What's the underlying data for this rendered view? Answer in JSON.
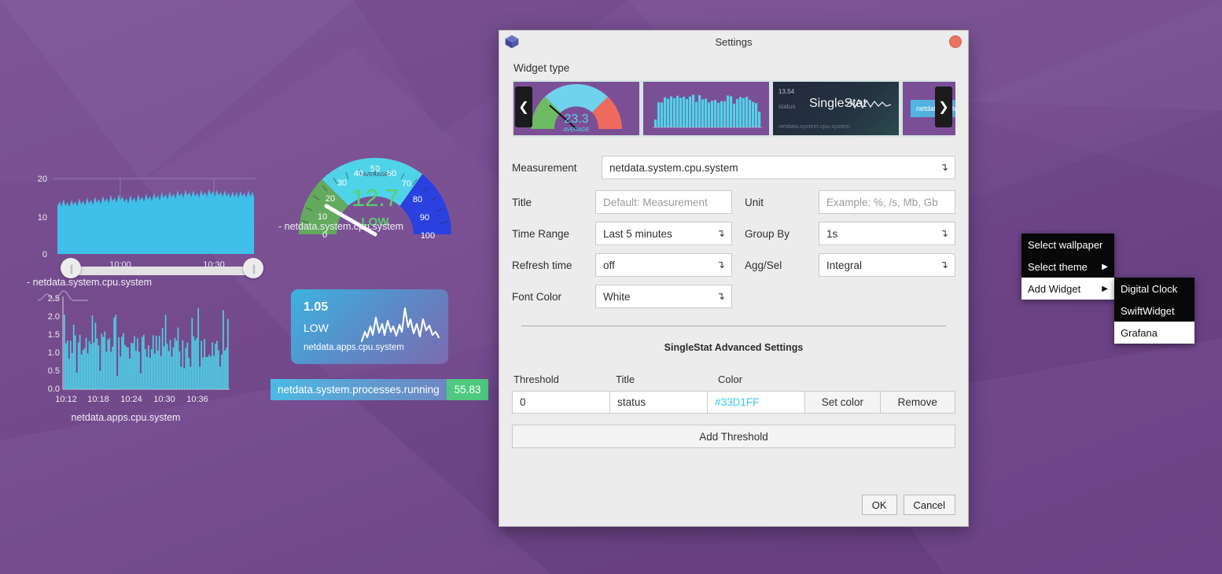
{
  "desktop": {
    "wallpaper_color": "#7b4f96",
    "widgets": {
      "top_chart": {
        "caption": "- netdata.system.cpu.system",
        "y_ticks": [
          "20",
          "10",
          "0"
        ],
        "x_ticks": [
          "10:00",
          "10:30"
        ],
        "slider_handle_glyph": "||"
      },
      "gauge": {
        "value": "12.7",
        "status": "LOW",
        "band_label": "AVERAGE",
        "caption": "- netdata.system.cpu.system",
        "ticks": [
          "0",
          "10",
          "20",
          "30",
          "40",
          "50",
          "60",
          "70",
          "80",
          "90",
          "100"
        ],
        "color_green": "#63a95e",
        "color_cyan": "#4fd3e8",
        "color_blue": "#2a41e0",
        "value_color": "#5ad06a"
      },
      "bottom_chart": {
        "caption": "netdata.apps.cpu.system",
        "y_ticks": [
          "2.5",
          "2.0",
          "1.5",
          "1.0",
          "0.5",
          "0.0"
        ],
        "x_ticks": [
          "10:12",
          "10:18",
          "10:24",
          "10:30",
          "10:36"
        ]
      },
      "singlestat_card": {
        "value": "1.05",
        "status": "LOW",
        "name": "netdata.apps.cpu.system"
      },
      "pill": {
        "label": "netdata.system.processes.running",
        "value": "55.83",
        "value_bg": "#4ec97f"
      }
    }
  },
  "dialog": {
    "title": "Settings",
    "app_icon": "cube-icon",
    "close_icon": "close-circle-icon",
    "widget_type_label": "Widget type",
    "carousel": {
      "prev_icon": "chevron-left-icon",
      "next_icon": "chevron-right-icon",
      "thumbnails": [
        {
          "name": "gauge",
          "value": "23.3",
          "caption": "AVERAGE"
        },
        {
          "name": "bar-chart",
          "value": "",
          "caption": ""
        },
        {
          "name": "singlestat",
          "value": "13.54",
          "status": "status",
          "measurement": "netdata.system.cpu.system",
          "title": "SingleStat",
          "selected": true
        },
        {
          "name": "label",
          "value": "netdata.system.cpu.sy",
          "caption": ""
        }
      ]
    },
    "fields": {
      "measurement": {
        "label": "Measurement",
        "value": "netdata.system.cpu.system"
      },
      "title": {
        "label": "Title",
        "value": "",
        "placeholder": "Default: Measurement"
      },
      "unit": {
        "label": "Unit",
        "value": "",
        "placeholder": "Example: %, /s, Mb, Gb"
      },
      "time_range": {
        "label": "Time Range",
        "value": "Last 5 minutes"
      },
      "group_by": {
        "label": "Group By",
        "value": "1s"
      },
      "refresh_time": {
        "label": "Refresh time",
        "value": "off"
      },
      "agg_sel": {
        "label": "Agg/Sel",
        "value": "Integral"
      },
      "font_color": {
        "label": "Font Color",
        "value": "White"
      }
    },
    "advanced": {
      "title": "SingleStat Advanced Settings",
      "columns": {
        "threshold": "Threshold",
        "title": "Title",
        "color": "Color"
      },
      "rows": [
        {
          "threshold": "0",
          "title": "status",
          "color": "#33D1FF",
          "set_color_label": "Set color",
          "remove_label": "Remove"
        }
      ],
      "add_threshold_label": "Add Threshold",
      "color_text_color": "#39c8f0"
    },
    "footer": {
      "ok": "OK",
      "cancel": "Cancel"
    }
  },
  "context_menu": {
    "items": [
      {
        "label": "Select wallpaper",
        "has_submenu": false,
        "active": false
      },
      {
        "label": "Select theme",
        "has_submenu": true,
        "active": false
      },
      {
        "label": "Add Widget",
        "has_submenu": true,
        "active": true
      }
    ],
    "submenu_arrow": "▶",
    "submenu": {
      "items": [
        {
          "label": "Digital Clock",
          "active": false
        },
        {
          "label": "SwiftWidget",
          "active": false
        },
        {
          "label": "Grafana",
          "active": true
        }
      ]
    }
  }
}
